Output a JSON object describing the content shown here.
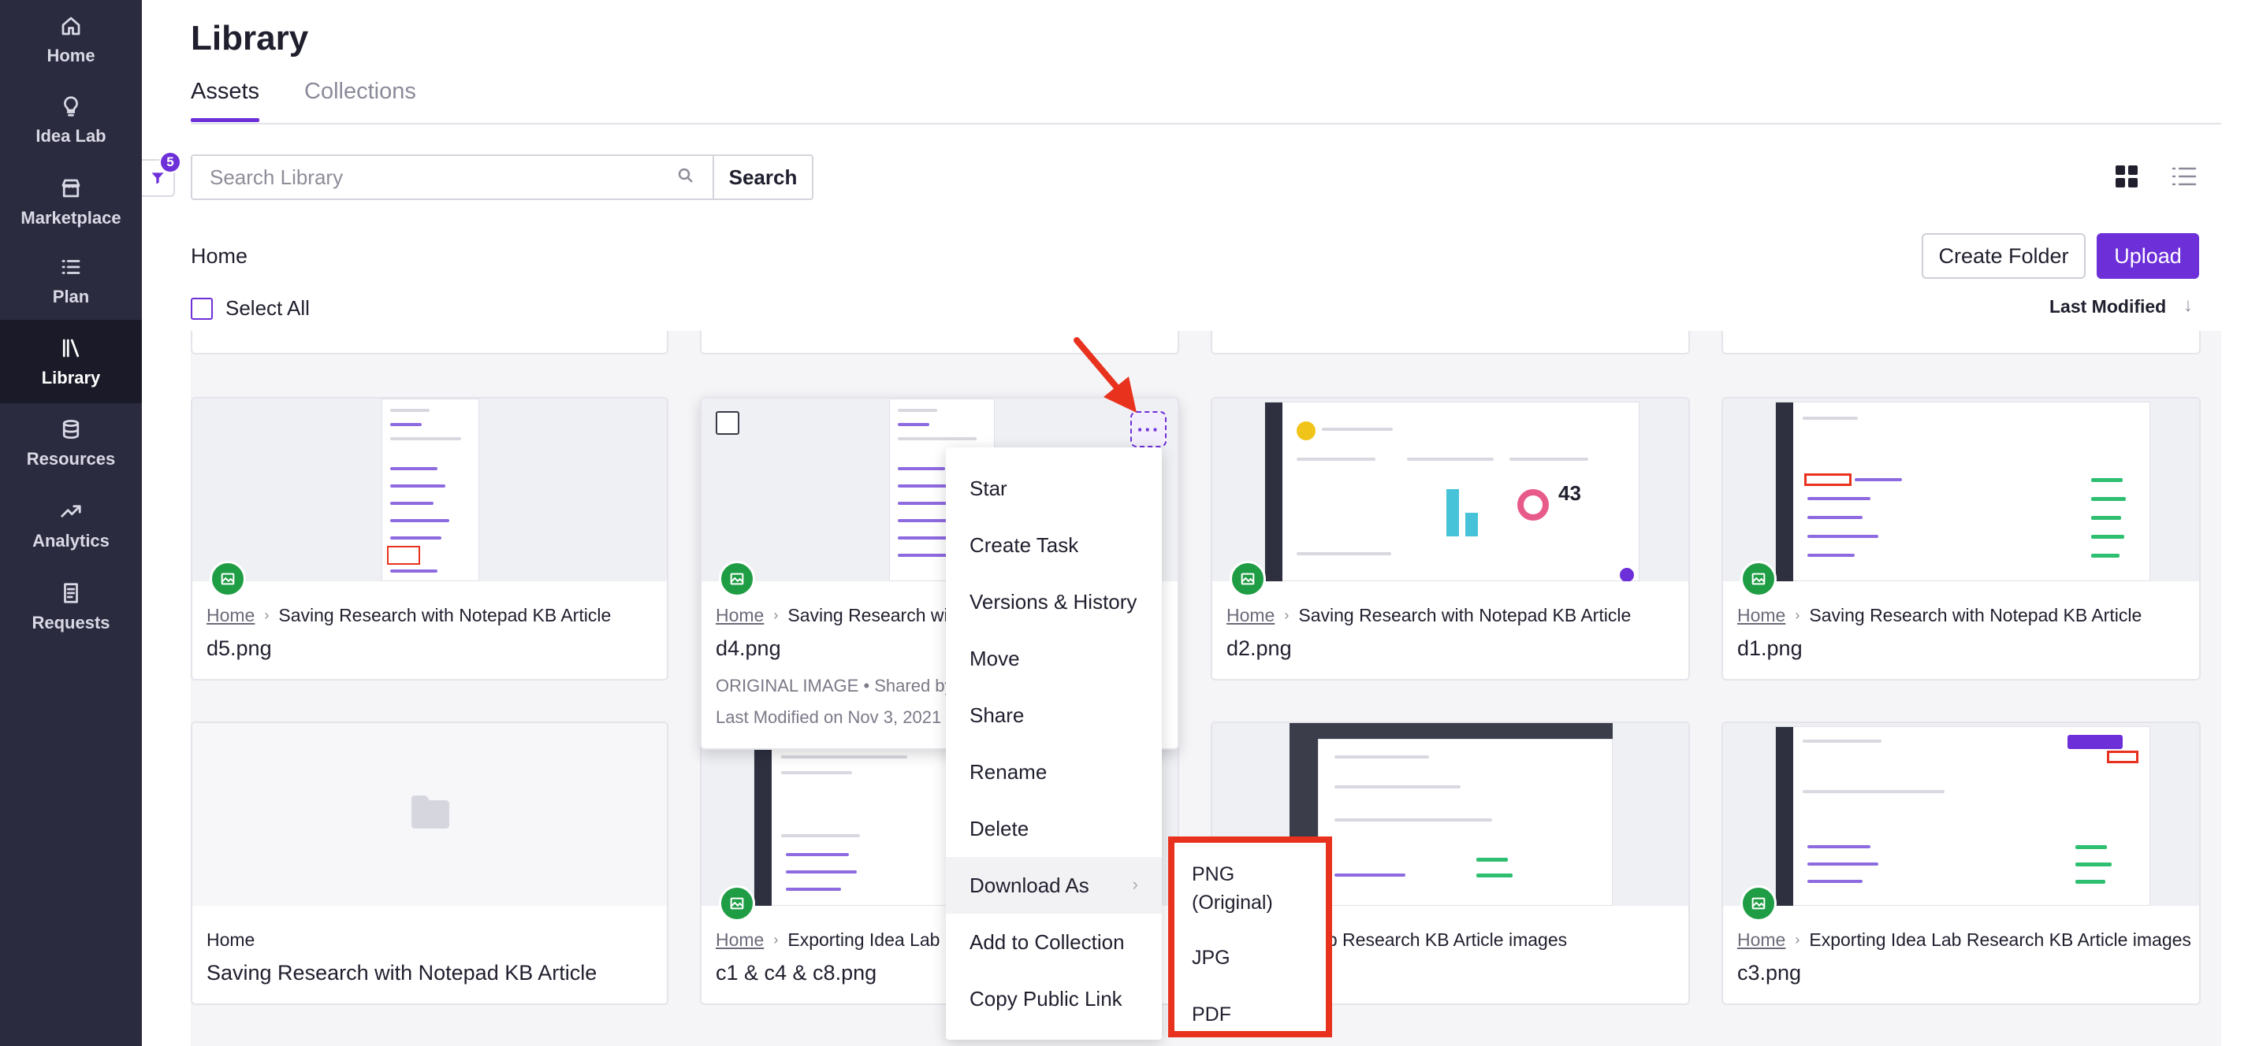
{
  "sidebar": {
    "items": [
      {
        "label": "Home",
        "icon": "home-icon"
      },
      {
        "label": "Idea Lab",
        "icon": "lightbulb-icon"
      },
      {
        "label": "Marketplace",
        "icon": "store-icon"
      },
      {
        "label": "Plan",
        "icon": "list-icon"
      },
      {
        "label": "Library",
        "icon": "library-icon",
        "active": true
      },
      {
        "label": "Resources",
        "icon": "database-icon"
      },
      {
        "label": "Analytics",
        "icon": "trend-icon"
      },
      {
        "label": "Requests",
        "icon": "document-icon"
      }
    ]
  },
  "page": {
    "title": "Library",
    "tabs": [
      {
        "label": "Assets",
        "active": true
      },
      {
        "label": "Collections"
      }
    ],
    "filter_count": "5",
    "search": {
      "placeholder": "Search Library",
      "button": "Search"
    },
    "breadcrumb": "Home",
    "buttons": {
      "create_folder": "Create Folder",
      "upload": "Upload"
    },
    "select_all": "Select All",
    "sort": {
      "label": "Last Modified",
      "arrow": "↓"
    }
  },
  "cards": [
    {
      "crumb_parent": "Home",
      "crumb_current": "Saving Research with Notepad KB Article",
      "name": "d5.png"
    },
    {
      "crumb_parent": "Home",
      "crumb_current": "Saving Research with Notepad KB Article",
      "name": "d4.png",
      "meta_type": "ORIGINAL IMAGE • Shared by",
      "meta_modified": "Last Modified on Nov 3, 2021"
    },
    {
      "crumb_parent": "Home",
      "crumb_current": "Saving Research with Notepad KB Article",
      "name": "d2.png"
    },
    {
      "crumb_parent": "Home",
      "crumb_current": "Saving Research with Notepad KB Article",
      "name": "d1.png"
    },
    {
      "crumb_parent": "Home",
      "name": "Saving Research with Notepad KB Article",
      "kind": "folder"
    },
    {
      "crumb_parent": "Home",
      "crumb_current": "Exporting Idea Lab R",
      "name": "c1 & c4 & c8.png"
    },
    {
      "crumb_current": "rting Idea Lab Research KB Article images"
    },
    {
      "crumb_parent": "Home",
      "crumb_current": "Exporting Idea Lab Research KB Article images",
      "name": "c3.png"
    }
  ],
  "context_menu": {
    "more_label": "···",
    "items": [
      "Star",
      "Create Task",
      "Versions & History",
      "Move",
      "Share",
      "Rename",
      "Delete",
      "Download As",
      "Add to Collection",
      "Copy Public Link"
    ],
    "chevron": "›"
  },
  "download_submenu": {
    "items": [
      "PNG (Original)",
      "JPG",
      "PDF"
    ]
  },
  "colors": {
    "sidebar": "#2b2b3f",
    "sidebar_active": "#1a1a28",
    "accent": "#6d2fd8",
    "badge_green": "#1f9d45",
    "annotation_red": "#e8321e"
  }
}
